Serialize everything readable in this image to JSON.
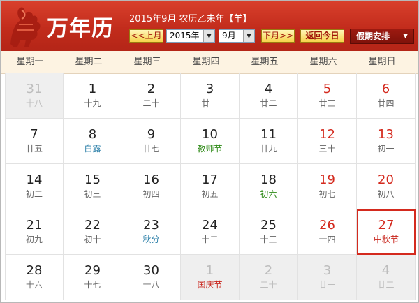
{
  "header": {
    "logo_text": "万年历",
    "subtitle": "2015年9月 农历乙未年【羊】",
    "prev_label": "<<上月",
    "year_value": "2015年",
    "month_value": "9月",
    "next_label": "下月>>",
    "today_label": "返回今日",
    "holiday_label": "假期安排"
  },
  "weekdays": [
    "星期一",
    "星期二",
    "星期三",
    "星期四",
    "星期五",
    "星期六",
    "星期日"
  ],
  "weeks": [
    [
      {
        "day": "31",
        "lunar": "十八",
        "other": true
      },
      {
        "day": "1",
        "lunar": "十九"
      },
      {
        "day": "2",
        "lunar": "二十"
      },
      {
        "day": "3",
        "lunar": "廿一"
      },
      {
        "day": "4",
        "lunar": "廿二"
      },
      {
        "day": "5",
        "lunar": "廿三"
      },
      {
        "day": "6",
        "lunar": "廿四"
      }
    ],
    [
      {
        "day": "7",
        "lunar": "廿五"
      },
      {
        "day": "8",
        "lunar": "白露",
        "kind": "blue"
      },
      {
        "day": "9",
        "lunar": "廿七"
      },
      {
        "day": "10",
        "lunar": "教师节",
        "kind": "green"
      },
      {
        "day": "11",
        "lunar": "廿九"
      },
      {
        "day": "12",
        "lunar": "三十"
      },
      {
        "day": "13",
        "lunar": "初一"
      }
    ],
    [
      {
        "day": "14",
        "lunar": "初二"
      },
      {
        "day": "15",
        "lunar": "初三"
      },
      {
        "day": "16",
        "lunar": "初四"
      },
      {
        "day": "17",
        "lunar": "初五"
      },
      {
        "day": "18",
        "lunar": "初六",
        "kind": "green"
      },
      {
        "day": "19",
        "lunar": "初七"
      },
      {
        "day": "20",
        "lunar": "初八"
      }
    ],
    [
      {
        "day": "21",
        "lunar": "初九"
      },
      {
        "day": "22",
        "lunar": "初十"
      },
      {
        "day": "23",
        "lunar": "秋分",
        "kind": "blue"
      },
      {
        "day": "24",
        "lunar": "十二"
      },
      {
        "day": "25",
        "lunar": "十三"
      },
      {
        "day": "26",
        "lunar": "十四"
      },
      {
        "day": "27",
        "lunar": "中秋节",
        "kind": "red",
        "selected": true
      }
    ],
    [
      {
        "day": "28",
        "lunar": "十六"
      },
      {
        "day": "29",
        "lunar": "十七"
      },
      {
        "day": "30",
        "lunar": "十八"
      },
      {
        "day": "1",
        "lunar": "国庆节",
        "other": true,
        "kind": "red"
      },
      {
        "day": "2",
        "lunar": "二十",
        "other": true
      },
      {
        "day": "3",
        "lunar": "廿一",
        "other": true
      },
      {
        "day": "4",
        "lunar": "廿二",
        "other": true
      }
    ]
  ],
  "colors": {
    "header_red": "#c22c1c",
    "weekend_red": "#d42a1e",
    "button_yellow": "#f6d34c",
    "festival_green": "#2f8a18",
    "solar_term_blue": "#2b7fa8"
  }
}
